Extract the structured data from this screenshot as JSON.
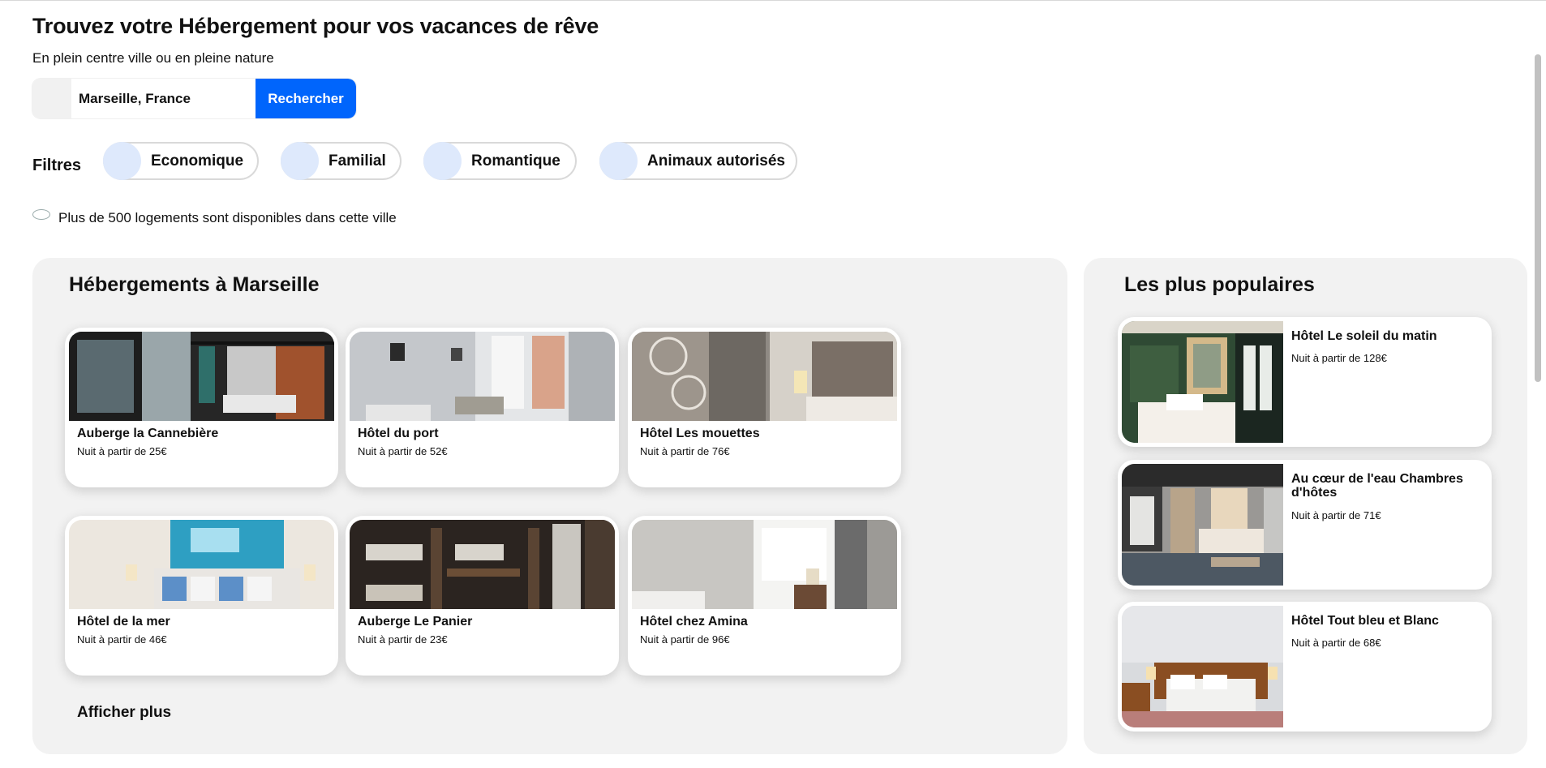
{
  "header": {
    "title": "Trouvez votre Hébergement pour vos vacances de rêve",
    "subtitle": "En plein centre ville ou en pleine nature"
  },
  "search": {
    "value": "Marseille, France",
    "button_label": "Rechercher",
    "icon": "search-icon"
  },
  "filters": {
    "label": "Filtres",
    "items": [
      {
        "label": "Economique",
        "icon": "money-icon"
      },
      {
        "label": "Familial",
        "icon": "family-icon"
      },
      {
        "label": "Romantique",
        "icon": "heart-icon"
      },
      {
        "label": "Animaux autorisés",
        "icon": "paw-icon"
      }
    ]
  },
  "info": {
    "text": "Plus de 500 logements sont disponibles dans cette ville",
    "icon": "info-icon"
  },
  "main": {
    "title": "Hébergements à Marseille",
    "cards": [
      {
        "name": "Auberge la Cannebière",
        "price": "Nuit à partir de 25€"
      },
      {
        "name": "Hôtel du port",
        "price": "Nuit à partir de 52€"
      },
      {
        "name": "Hôtel Les mouettes",
        "price": "Nuit à partir de 76€"
      },
      {
        "name": "Hôtel de la mer",
        "price": "Nuit à partir de 46€"
      },
      {
        "name": "Auberge Le Panier",
        "price": "Nuit à partir de 23€"
      },
      {
        "name": "Hôtel chez Amina",
        "price": "Nuit à partir de 96€"
      }
    ],
    "show_more": "Afficher plus"
  },
  "popular": {
    "title": "Les plus populaires",
    "cards": [
      {
        "name": "Hôtel Le soleil du matin",
        "price": "Nuit à partir de 128€"
      },
      {
        "name": "Au cœur de l'eau Chambres d'hôtes",
        "price": "Nuit à partir de 71€"
      },
      {
        "name": "Hôtel Tout bleu et Blanc",
        "price": "Nuit à partir de 68€"
      }
    ]
  },
  "colors": {
    "accent": "#0065fc",
    "chip_icon_bg": "#dee9fc",
    "panel_bg": "#f2f2f2"
  }
}
